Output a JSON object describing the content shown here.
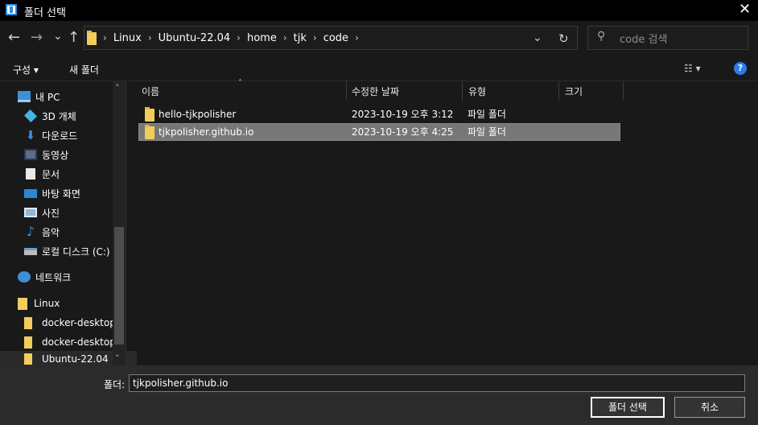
{
  "window": {
    "title": "폴더 선택",
    "close_glyph": "✕"
  },
  "nav": {
    "back": "←",
    "forward": "→",
    "recent": "⌄",
    "up": "↑",
    "dropdown": "⌄",
    "refresh": "↻"
  },
  "breadcrumb": [
    "Linux",
    "Ubuntu-22.04",
    "home",
    "tjk",
    "code"
  ],
  "breadcrumb_sep": "›",
  "search": {
    "placeholder": "code 검색",
    "icon": "⚲"
  },
  "toolbar": {
    "organize": "구성 ▾",
    "new_folder": "새 폴더",
    "view": "☷ ▾",
    "help": "?"
  },
  "sidebar": {
    "items": [
      {
        "label": "내 PC",
        "icon": "pc-icon"
      },
      {
        "label": "3D 개체",
        "icon": "3d-objects-icon"
      },
      {
        "label": "다운로드",
        "icon": "download-icon"
      },
      {
        "label": "동영상",
        "icon": "video-icon"
      },
      {
        "label": "문서",
        "icon": "document-icon"
      },
      {
        "label": "바탕 화면",
        "icon": "desktop-icon"
      },
      {
        "label": "사진",
        "icon": "picture-icon"
      },
      {
        "label": "음악",
        "icon": "music-icon"
      },
      {
        "label": "로컬 디스크 (C:)",
        "icon": "disk-icon"
      },
      {
        "label": "네트워크",
        "icon": "network-icon"
      },
      {
        "label": "Linux",
        "icon": "linux-folder-icon"
      },
      {
        "label": "docker-desktop",
        "icon": "folder-icon"
      },
      {
        "label": "docker-desktop-",
        "icon": "folder-icon"
      },
      {
        "label": "Ubuntu-22.04",
        "icon": "folder-icon"
      }
    ],
    "scroll_up": "˄",
    "scroll_down": "˅"
  },
  "columns": {
    "name": "이름",
    "modified": "수정한 날짜",
    "type": "유형",
    "size": "크기",
    "sort_indicator": "˄"
  },
  "files": [
    {
      "name": "hello-tjkpolisher",
      "modified": "2023-10-19 오후 3:12",
      "type": "파일 폴더"
    },
    {
      "name": "tjkpolisher.github.io",
      "modified": "2023-10-19 오후 4:25",
      "type": "파일 폴더"
    }
  ],
  "footer": {
    "folder_label": "폴더:",
    "folder_value": "tjkpolisher.github.io",
    "select_button": "폴더 선택",
    "cancel_button": "취소"
  },
  "colors": {
    "accent": "#2b7de9",
    "folder": "#f3cd5b",
    "selection": "#777777"
  }
}
